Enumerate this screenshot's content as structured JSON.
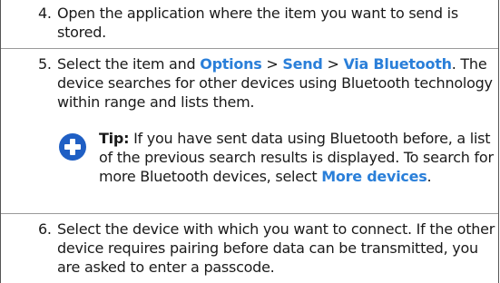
{
  "steps": [
    {
      "number": "4.",
      "text": "Open the application where the item you want to send is stored."
    },
    {
      "number": "5.",
      "intro": "Select the item and ",
      "menu_1": "Options",
      "sep_1": " > ",
      "menu_2": "Send",
      "sep_2": " > ",
      "menu_3": "Via Bluetooth",
      "rest": ". The device searches for other devices using Bluetooth technology within range and lists them."
    },
    {
      "number": "6.",
      "text": "Select the device with which you want to connect. If the other device requires pairing before data can be transmitted, you are asked to enter a passcode."
    }
  ],
  "tip": {
    "label": "Tip:",
    "text": " If you have sent data using Bluetooth before, a list of the previous search results is displayed. To search for more Bluetooth devices, select ",
    "link": "More devices",
    "end": ".",
    "icon": "plus-circle-icon",
    "icon_color": "#1f5fc4"
  },
  "colors": {
    "link": "#2a7fd9",
    "divider": "#9a9a9a",
    "frame": "#555555"
  }
}
